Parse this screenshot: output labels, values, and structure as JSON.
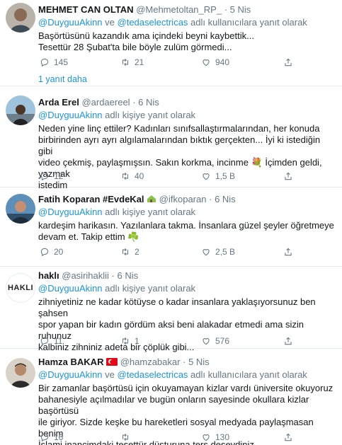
{
  "colors": {
    "accent": "#1b95e0",
    "muted": "#657786",
    "text": "#14171a",
    "divider": "#e6ecf0"
  },
  "tweets": [
    {
      "name": "MEHMET CAN OLTAN",
      "handle": "@Mehmetoltan_RP_",
      "sep": "·",
      "time": "5 Nis",
      "reply_prefix": "",
      "mentions": [
        "@DuyguuAkinn",
        "@tedaselectricas"
      ],
      "mention_joiner": "ve",
      "reply_suffix": "adlı kullanıcılara yanıt olarak",
      "text": "Başörtüsünü kazandık ama içindeki beyni kaybettik...\nTesettür 28 Şubat'ta bile böyle zulüm görmedi...",
      "replies": "145",
      "retweets": "21",
      "likes": "940",
      "more_replies": "1 yanıt daha"
    },
    {
      "name": "Arda Erel",
      "handle": "@ardaereel",
      "sep": "·",
      "time": "6 Nis",
      "mentions": [
        "@DuyguuAkinn"
      ],
      "reply_suffix": "adlı kişiye yanıt olarak",
      "text": "Neden yine linç ettiler? Kadınları sınıfsallaştırmalarından, her konuda\nbirbirinden ayrı ayrı algılamalarından bıktık gerçekten... İyi ki istediğin gibi\nvideo çekmiş, paylaşmışsın. Sakın korkma, incinme 💐 İçimden geldi, yazmak\nistedim",
      "replies": "12",
      "retweets": "40",
      "likes": "1,5 B"
    },
    {
      "name": "Fatih Koparan #EvdeKal",
      "name_emoji": "house-emoji",
      "handle": "@ifkoparan",
      "sep": "·",
      "time": "6 Nis",
      "mentions": [
        "@DuyguuAkinn"
      ],
      "reply_suffix": "adlı kişiye yanıt olarak",
      "text": "kardeşim harikasın. Yazılanlara takma. İnsanlara güzel şeyler öğretmeye\ndevam et. Takip ettim ☘️",
      "replies": "20",
      "retweets": "2",
      "likes": "2,5 B"
    },
    {
      "name": "haklı",
      "handle": "@asirihaklii",
      "sep": "·",
      "time": "6 Nis",
      "avatar_text": "HAKLI",
      "mentions": [
        "@DuyguuAkinn"
      ],
      "reply_suffix": "adlı kişiye yanıt olarak",
      "text": "zihniyetiniz ne kadar kötüyse o kadar insanlara yaklaşıyorsunuz ben şahsen\nspor yapan bir kadın gördüm aksi beni alakadar etmedi ama sizin ruhunuz\nkalbiniz zihniniz adeta bir çöplük gibi...",
      "replies": "11",
      "retweets": "1",
      "likes": "576"
    },
    {
      "name": "Hamza BAKAR",
      "name_emoji": "turkey-flag",
      "handle": "@hamzabakar",
      "sep": "·",
      "time": "5 Nis",
      "mentions": [
        "@DuyguuAkinn",
        "@tedaselectricas"
      ],
      "mention_joiner": "ve",
      "reply_suffix": "adlı kullanıcılara yanıt olarak",
      "text": "Bir zamanlar başörtüsü için okuyamayan kizlar vardı üniversite okuyoruz\nbahanesiyle açılmadılar ve bugün onların sayesinde okullara kizlar başörtüsü\nile giriyor. Sizde keşke bu hareketleri sosyal medyada paylaşmasan benim\nİslami inancimdaki tesettür düsturuna ters deseydiniz.",
      "replies": "16",
      "retweets": "",
      "likes": "130"
    }
  ]
}
